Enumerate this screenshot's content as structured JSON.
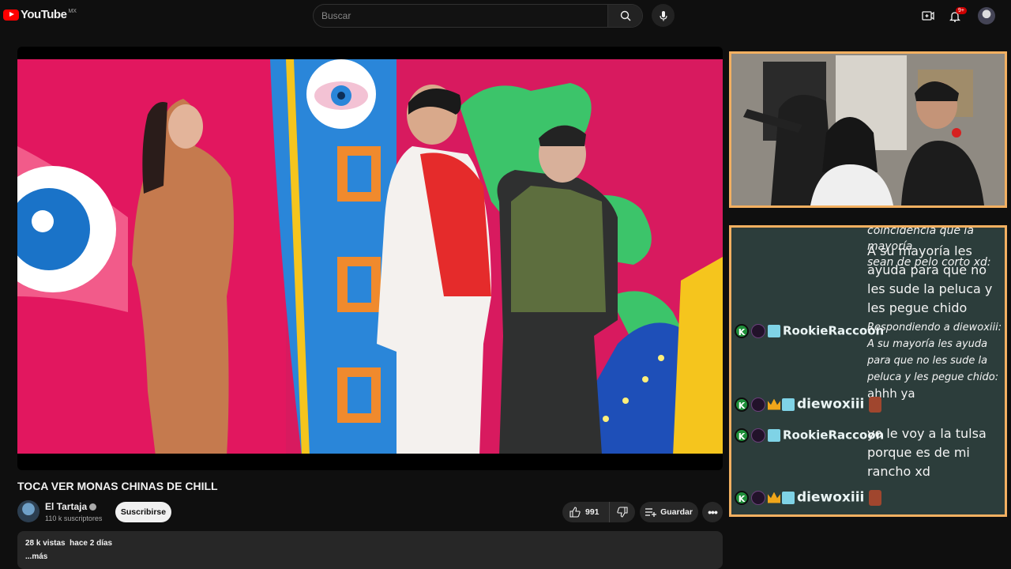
{
  "header": {
    "logo_text": "YouTube",
    "country": "MX",
    "search_placeholder": "Buscar",
    "notifications_badge": "9+"
  },
  "video": {
    "title": "TOCA VER MONAS CHINAS DE CHILL",
    "channel_name": "El Tartaja",
    "subscribers": "110 k suscriptores",
    "subscribe_label": "Suscribirse",
    "likes": "991",
    "save_label": "Guardar",
    "views": "28 k vistas",
    "date": "hace 2 días",
    "more_label": "...más"
  },
  "chat": {
    "messages": [
      {
        "user": "",
        "text_lines": [
          "coincidencia que la mayoría",
          "sean de pelo corto xd:"
        ],
        "text": "A su mayoría les ayuda para que no les sude la peluca y les pegue chido"
      },
      {
        "user": "RookieRaccoon",
        "reply": "Respondiendo a diewoxiii: A su mayoría les ayuda para que no les sude la peluca y les pegue chido:",
        "text": "ahhh ya"
      },
      {
        "user": "diewoxiii",
        "text": ""
      },
      {
        "user": "RookieRaccoon",
        "text": "yo le voy a la tulsa porque es de mi rancho xd"
      },
      {
        "user": "diewoxiii",
        "text": ""
      }
    ]
  },
  "colors": {
    "background": "#0f0f0f",
    "accent_red": "#ff0000",
    "chat_border": "#f3b061",
    "chat_bg": "#2c3d3b"
  },
  "icons": [
    "youtube-logo-icon",
    "search-icon",
    "mic-icon",
    "create-icon",
    "bell-icon",
    "like-icon",
    "dislike-icon",
    "save-icon",
    "more-icon"
  ]
}
